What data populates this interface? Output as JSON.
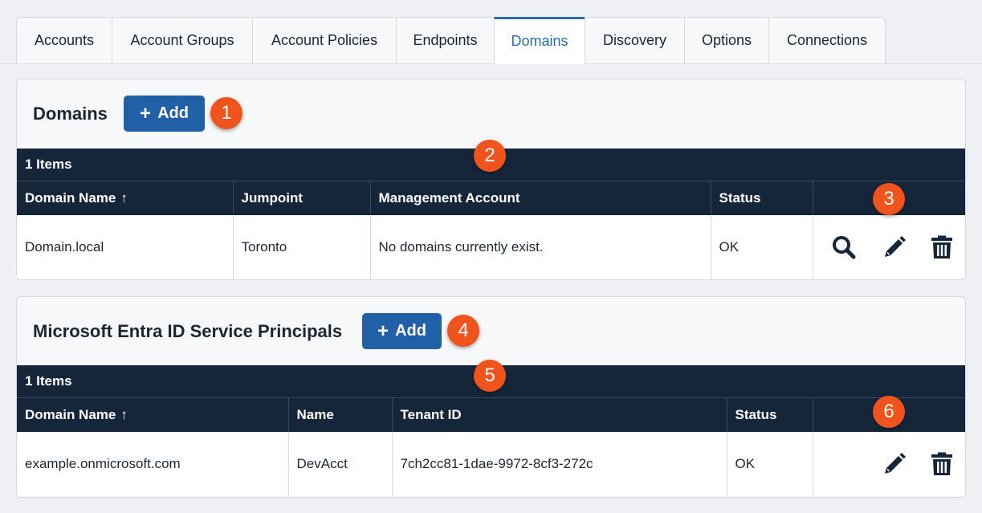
{
  "tabs": [
    "Accounts",
    "Account Groups",
    "Account Policies",
    "Endpoints",
    "Domains",
    "Discovery",
    "Options",
    "Connections"
  ],
  "active_tab": "Domains",
  "domains_section": {
    "title": "Domains",
    "add_label": "Add",
    "items_count": "1 Items",
    "columns": [
      "Domain Name",
      "Jumpoint",
      "Management Account",
      "Status",
      ""
    ],
    "sort_indicator": "↑",
    "rows": [
      {
        "domain_name": "Domain.local",
        "jumpoint": "Toronto",
        "management_account": "No domains currently exist.",
        "status": "OK"
      }
    ],
    "row_actions": [
      "search-icon",
      "pencil-icon",
      "trash-icon"
    ]
  },
  "entra_section": {
    "title": "Microsoft Entra ID Service Principals",
    "add_label": "Add",
    "items_count": "1 Items",
    "columns": [
      "Domain Name",
      "Name",
      "Tenant ID",
      "Status",
      ""
    ],
    "sort_indicator": "↑",
    "rows": [
      {
        "domain_name": "example.onmicrosoft.com",
        "name": "DevAcct",
        "tenant_id": "7ch2cc81-1dae-9972-8cf3-272c",
        "status": "OK"
      }
    ],
    "row_actions": [
      "pencil-icon",
      "trash-icon"
    ]
  },
  "callouts": [
    "1",
    "2",
    "3",
    "4",
    "5",
    "6"
  ],
  "colors": {
    "accent": "#2f6aa8",
    "button": "#2160a6",
    "header_dark": "#16263a",
    "callout": "#f0531c"
  }
}
